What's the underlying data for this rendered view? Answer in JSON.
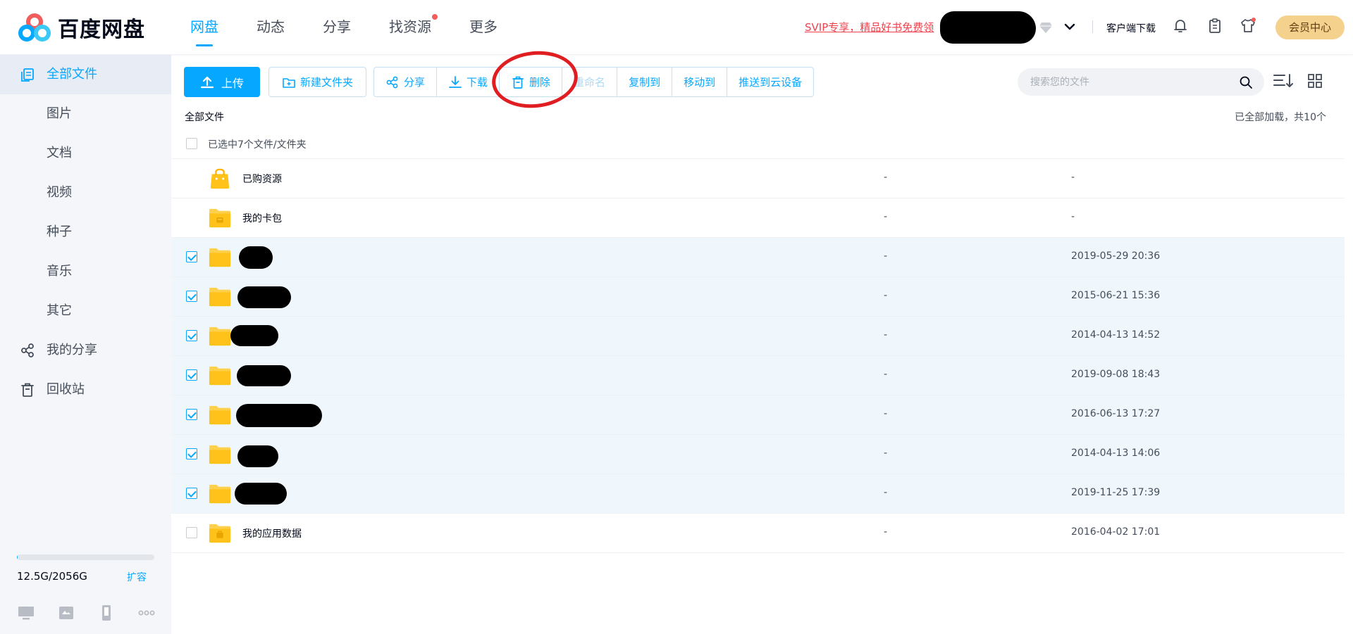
{
  "brand": {
    "name": "百度网盘"
  },
  "topnav": [
    {
      "label": "网盘",
      "active": true,
      "dot": false
    },
    {
      "label": "动态",
      "active": false,
      "dot": false
    },
    {
      "label": "分享",
      "active": false,
      "dot": false
    },
    {
      "label": "找资源",
      "active": false,
      "dot": true
    },
    {
      "label": "更多",
      "active": false,
      "dot": false
    }
  ],
  "header": {
    "promo": "SVIP专享，精品好书免费领",
    "client_download": "客户端下载",
    "vip_center": "会员中心",
    "icons": [
      "bell-icon",
      "clipboard-icon",
      "shirt-icon"
    ]
  },
  "sidebar": {
    "items": [
      {
        "label": "全部文件",
        "icon": "files-icon",
        "active": true
      },
      {
        "label": "图片",
        "icon": "",
        "active": false
      },
      {
        "label": "文档",
        "icon": "",
        "active": false
      },
      {
        "label": "视频",
        "icon": "",
        "active": false
      },
      {
        "label": "种子",
        "icon": "",
        "active": false
      },
      {
        "label": "音乐",
        "icon": "",
        "active": false
      },
      {
        "label": "其它",
        "icon": "",
        "active": false
      },
      {
        "label": "我的分享",
        "icon": "share-icon",
        "active": false
      },
      {
        "label": "回收站",
        "icon": "trash-icon",
        "active": false
      }
    ],
    "storage": {
      "used_text": "12.5G/2056G",
      "expand": "扩容",
      "used_fraction": 0.006
    }
  },
  "toolbar": {
    "upload": "上传",
    "new_folder": "新建文件夹",
    "actions": [
      {
        "label": "分享",
        "icon": "share-icon",
        "disabled": false
      },
      {
        "label": "下载",
        "icon": "download-icon",
        "disabled": false
      },
      {
        "label": "删除",
        "icon": "delete-icon",
        "disabled": false
      },
      {
        "label": "重命名",
        "icon": "",
        "disabled": true
      },
      {
        "label": "复制到",
        "icon": "",
        "disabled": false
      },
      {
        "label": "移动到",
        "icon": "",
        "disabled": false
      },
      {
        "label": "推送到云设备",
        "icon": "",
        "disabled": false
      }
    ]
  },
  "search": {
    "placeholder": "搜索您的文件"
  },
  "breadcrumb": "全部文件",
  "loaded_text": "已全部加载，共10个",
  "list": {
    "selected_text": "已选中7个文件/文件夹",
    "rows": [
      {
        "name": "已购资源",
        "icon": "purchased-bag-icon",
        "size": "-",
        "time": "-",
        "checkbox": false,
        "checked": false,
        "redacted": false
      },
      {
        "name": "我的卡包",
        "icon": "card-folder-icon",
        "size": "-",
        "time": "-",
        "checkbox": false,
        "checked": false,
        "redacted": false
      },
      {
        "name": "",
        "icon": "folder-icon",
        "size": "-",
        "time": "2019-05-29 20:36",
        "checkbox": true,
        "checked": true,
        "redacted": true
      },
      {
        "name": "",
        "icon": "folder-icon",
        "size": "-",
        "time": "2015-06-21 15:36",
        "checkbox": true,
        "checked": true,
        "redacted": true
      },
      {
        "name": "",
        "icon": "folder-icon",
        "size": "-",
        "time": "2014-04-13 14:52",
        "checkbox": true,
        "checked": true,
        "redacted": true
      },
      {
        "name": "",
        "icon": "folder-icon",
        "size": "-",
        "time": "2019-09-08 18:43",
        "checkbox": true,
        "checked": true,
        "redacted": true
      },
      {
        "name": "",
        "icon": "folder-icon",
        "size": "-",
        "time": "2016-06-13 17:27",
        "checkbox": true,
        "checked": true,
        "redacted": true
      },
      {
        "name": "",
        "icon": "folder-icon",
        "size": "-",
        "time": "2014-04-13 14:06",
        "checkbox": true,
        "checked": true,
        "redacted": true
      },
      {
        "name": "",
        "icon": "folder-icon",
        "size": "-",
        "time": "2019-11-25 17:39",
        "checkbox": true,
        "checked": true,
        "redacted": true
      },
      {
        "name": "我的应用数据",
        "icon": "app-data-folder-icon",
        "size": "-",
        "time": "2016-04-02 17:01",
        "checkbox": true,
        "checked": false,
        "redacted": false
      }
    ]
  },
  "colors": {
    "accent": "#06a7ff",
    "promo": "#f0414d",
    "vip": "#f5d18e",
    "selected_row": "#eff7fd",
    "folder": "#ffd04b"
  }
}
